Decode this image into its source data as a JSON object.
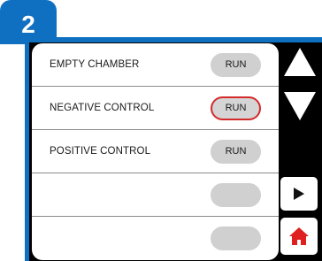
{
  "step": {
    "number": "2"
  },
  "rows": [
    {
      "label": "EMPTY CHAMBER",
      "button": "RUN",
      "selected": false
    },
    {
      "label": "NEGATIVE CONTROL",
      "button": "RUN",
      "selected": true
    },
    {
      "label": "POSITIVE CONTROL",
      "button": "RUN",
      "selected": false
    },
    {
      "label": "",
      "button": "",
      "selected": false
    },
    {
      "label": "",
      "button": "",
      "selected": false
    }
  ],
  "side_controls": {
    "up_icon": "triangle-up-icon",
    "down_icon": "triangle-down-icon",
    "play_icon": "play-icon",
    "home_icon": "home-icon"
  },
  "colors": {
    "frame_blue": "#0f6fc0",
    "selected_outline": "#d42a2a",
    "home_red": "#e02020",
    "button_gray": "#d0d0d0"
  }
}
